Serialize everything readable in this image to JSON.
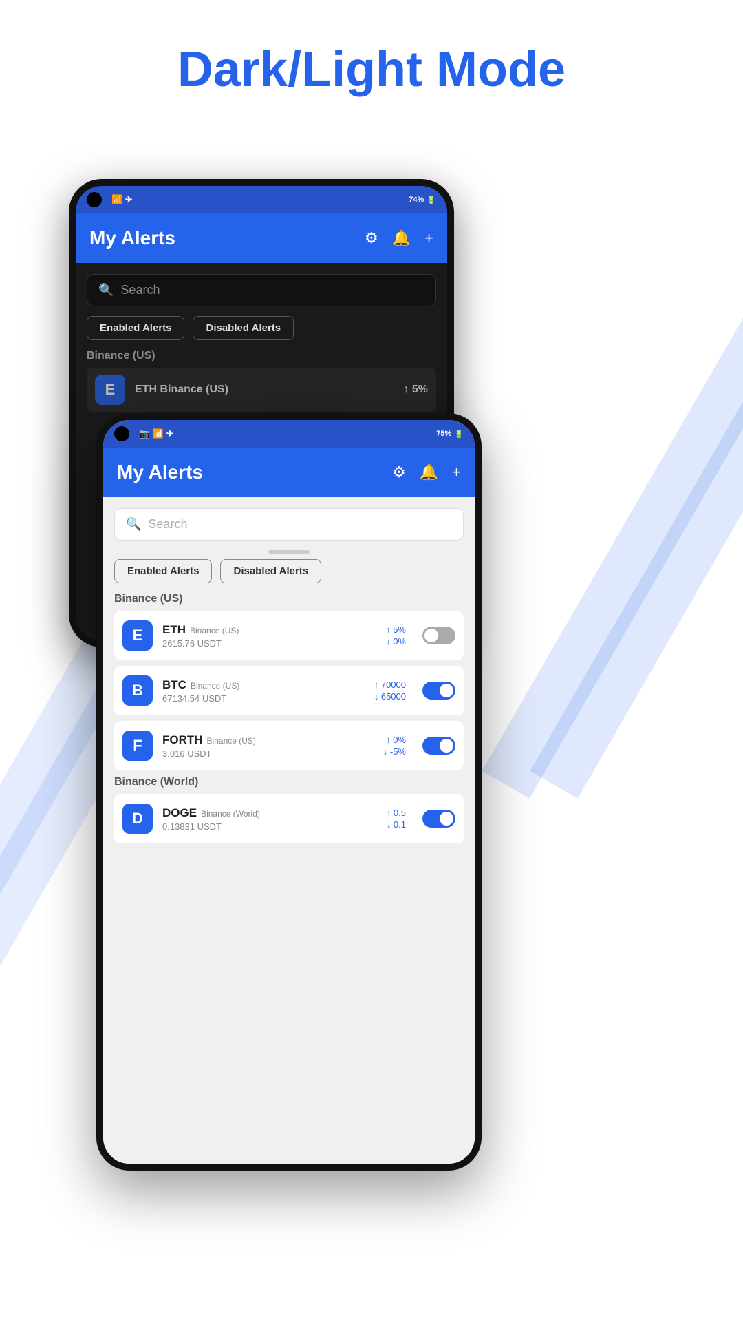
{
  "page": {
    "title": "Dark/Light Mode"
  },
  "dark_phone": {
    "status_bar": {
      "battery": "74%",
      "signal": "wifi"
    },
    "header": {
      "title": "My Alerts"
    },
    "search": {
      "placeholder": "Search"
    },
    "filters": {
      "enabled": "Enabled Alerts",
      "disabled": "Disabled Alerts"
    },
    "section": "Binance (US)",
    "partial_item": {
      "name": "ETH",
      "exchange": "Binance (US)",
      "value": "5%"
    }
  },
  "light_phone": {
    "status_bar": {
      "battery": "75%"
    },
    "header": {
      "title": "My Alerts"
    },
    "search": {
      "placeholder": "Search"
    },
    "filters": {
      "enabled": "Enabled Alerts",
      "disabled": "Disabled Alerts"
    },
    "sections": [
      {
        "name": "Binance (US)",
        "items": [
          {
            "letter": "E",
            "coin": "ETH",
            "exchange": "Binance (US)",
            "price": "2615.76 USDT",
            "up": "5%",
            "down": "0%",
            "enabled": false
          },
          {
            "letter": "B",
            "coin": "BTC",
            "exchange": "Binance (US)",
            "price": "67134.54 USDT",
            "up": "70000",
            "down": "65000",
            "enabled": true
          },
          {
            "letter": "F",
            "coin": "FORTH",
            "exchange": "Binance (US)",
            "price": "3.016 USDT",
            "up": "0%",
            "down": "-5%",
            "enabled": true
          }
        ]
      },
      {
        "name": "Binance (World)",
        "items": [
          {
            "letter": "D",
            "coin": "DOGE",
            "exchange": "Binance (World)",
            "price": "0.13831 USDT",
            "up": "0.5",
            "down": "0.1",
            "enabled": true
          }
        ]
      }
    ]
  },
  "icons": {
    "search": "🔍",
    "settings": "⚙",
    "bell": "🔔",
    "plus": "+",
    "arrow_up": "↑",
    "arrow_down": "↓"
  }
}
